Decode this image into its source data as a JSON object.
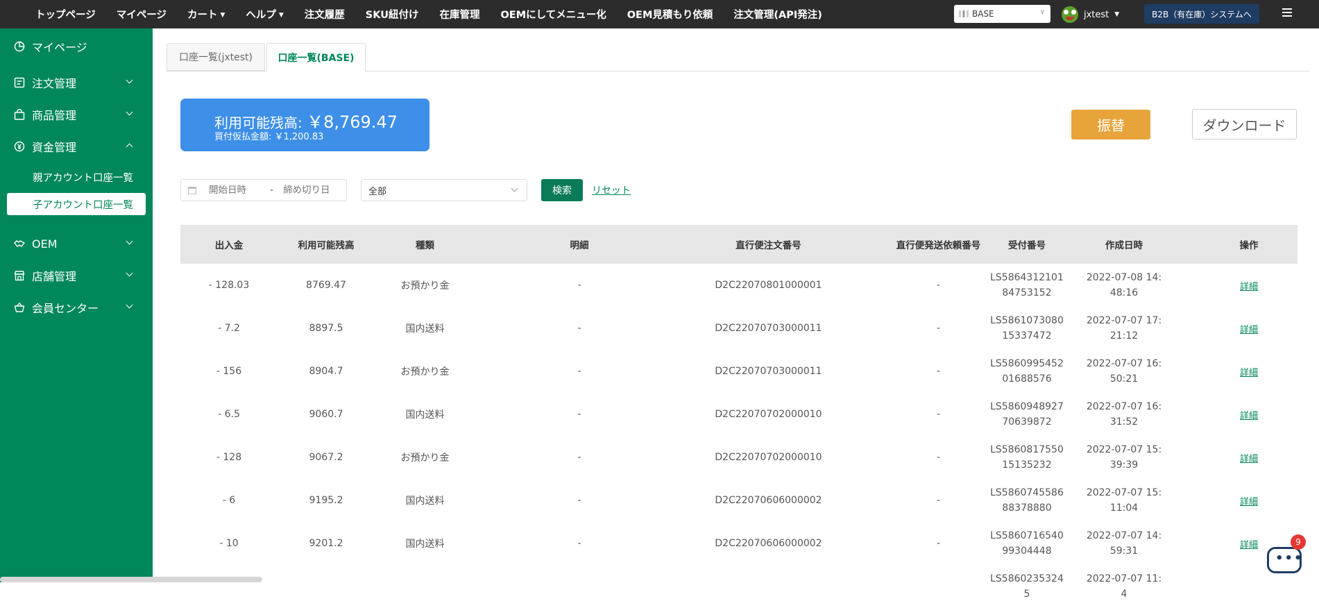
{
  "topnav": {
    "items": [
      {
        "label": "トップページ",
        "caret": false
      },
      {
        "label": "マイページ",
        "caret": false
      },
      {
        "label": "カート",
        "caret": true
      },
      {
        "label": "ヘルプ",
        "caret": true
      },
      {
        "label": "注文履歴",
        "caret": false
      },
      {
        "label": "SKU紐付け",
        "caret": false
      },
      {
        "label": "在庫管理",
        "caret": false
      },
      {
        "label": "OEMにしてメニュー化",
        "caret": false
      },
      {
        "label": "OEM見積もり依頼",
        "caret": false
      },
      {
        "label": "注文管理(API発注)",
        "caret": false
      }
    ],
    "shop_select": "BASE",
    "username": "jxtest",
    "b2b_button": "B2B（有在庫）システムへ"
  },
  "sidebar": {
    "mypage": "マイページ",
    "orders": "注文管理",
    "products": "商品管理",
    "funds": "資金管理",
    "funds_sub": [
      "親アカウント口座一覧",
      "子アカウント口座一覧"
    ],
    "oem": "OEM",
    "stores": "店舗管理",
    "members": "会員センター"
  },
  "tabs": [
    "口座一覧(jxtest)",
    "口座一覧(BASE)"
  ],
  "balance": {
    "label": "利用可能残高:",
    "amount": "￥8,769.47",
    "sub": "買付仮払金額: ￥1,200.83"
  },
  "actions": {
    "transfer": "振替",
    "download": "ダウンロード"
  },
  "filters": {
    "start_placeholder": "開始日時",
    "separator": "-",
    "end_placeholder": "締め切り日",
    "type_value": "全部",
    "search": "検索",
    "reset": "リセット"
  },
  "table": {
    "headers": [
      "出入金",
      "利用可能残高",
      "種類",
      "明細",
      "直行便注文番号",
      "直行便発送依頼番号",
      "受付番号",
      "作成日時",
      "操作"
    ],
    "rows": [
      {
        "amount": "- 128.03",
        "balance": "8769.47",
        "type": "お預かり金",
        "detail": "-",
        "order_no": "D2C22070801000001",
        "ship_no": "-",
        "receipt": "LS586431210184753152",
        "created": "2022-07-08 14:48:16",
        "action": "詳細"
      },
      {
        "amount": "- 7.2",
        "balance": "8897.5",
        "type": "国内送料",
        "detail": "-",
        "order_no": "D2C22070703000011",
        "ship_no": "-",
        "receipt": "LS586107308015337472",
        "created": "2022-07-07 17:21:12",
        "action": "詳細"
      },
      {
        "amount": "- 156",
        "balance": "8904.7",
        "type": "お預かり金",
        "detail": "-",
        "order_no": "D2C22070703000011",
        "ship_no": "-",
        "receipt": "LS586099545201688576",
        "created": "2022-07-07 16:50:21",
        "action": "詳細"
      },
      {
        "amount": "- 6.5",
        "balance": "9060.7",
        "type": "国内送料",
        "detail": "-",
        "order_no": "D2C22070702000010",
        "ship_no": "-",
        "receipt": "LS586094892770639872",
        "created": "2022-07-07 16:31:52",
        "action": "詳細"
      },
      {
        "amount": "- 128",
        "balance": "9067.2",
        "type": "お預かり金",
        "detail": "-",
        "order_no": "D2C22070702000010",
        "ship_no": "-",
        "receipt": "LS586081755015135232",
        "created": "2022-07-07 15:39:39",
        "action": "詳細"
      },
      {
        "amount": "- 6",
        "balance": "9195.2",
        "type": "国内送料",
        "detail": "-",
        "order_no": "D2C22070606000002",
        "ship_no": "-",
        "receipt": "LS586074558688378880",
        "created": "2022-07-07 15:11:04",
        "action": "詳細"
      },
      {
        "amount": "- 10",
        "balance": "9201.2",
        "type": "国内送料",
        "detail": "-",
        "order_no": "D2C22070606000002",
        "ship_no": "-",
        "receipt": "LS586071654099304448",
        "created": "2022-07-07 14:59:31",
        "action": "詳細"
      },
      {
        "amount": "",
        "balance": "",
        "type": "",
        "detail": "",
        "order_no": "",
        "ship_no": "",
        "receipt": "LS58602353245",
        "created": "2022-07-07 11:4",
        "action": ""
      }
    ]
  },
  "chat": {
    "badge": "9"
  }
}
